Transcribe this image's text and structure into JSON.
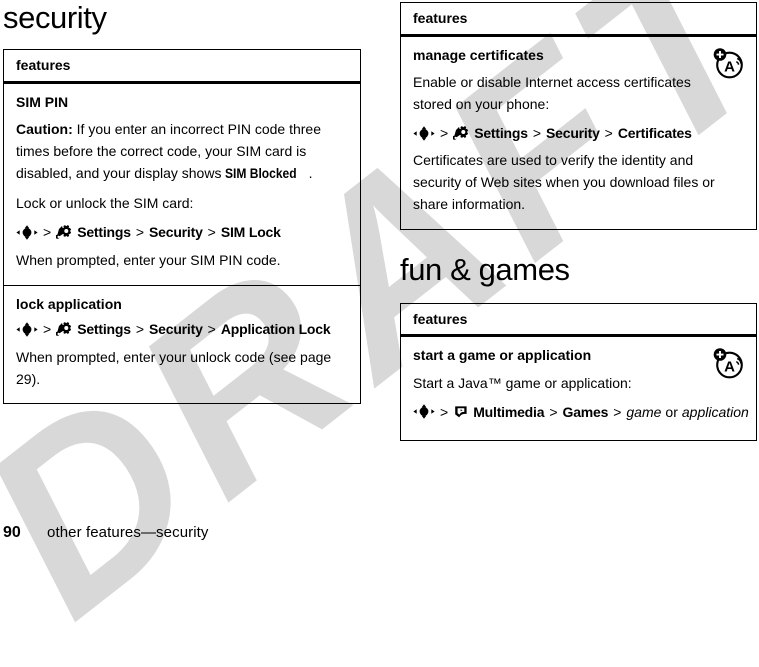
{
  "watermark": {
    "text": "DRAFT"
  },
  "footer": {
    "page_number": "90",
    "running_head": "other features—security"
  },
  "colors": {
    "text": "#000000",
    "rule": "#000000",
    "watermark": "#d8d8d8",
    "background": "#ffffff"
  },
  "left_column": {
    "chapter_title": "security",
    "table": {
      "header": "features",
      "rows": [
        {
          "title": "SIM PIN",
          "blocks": [
            {
              "kind": "paragraph",
              "runs": [
                {
                  "text": "Caution:",
                  "style": "bold"
                },
                {
                  "text": " If you enter an incorrect PIN code three times before the correct code, your SIM card is disabled, and your display shows ",
                  "style": "normal"
                },
                {
                  "text": "SIM Blocked",
                  "style": "screen"
                },
                {
                  "text": ".",
                  "style": "normal"
                }
              ]
            },
            {
              "kind": "paragraph",
              "runs": [
                {
                  "text": "Lock or unlock the SIM card:",
                  "style": "normal"
                }
              ]
            },
            {
              "kind": "menu_path",
              "items": [
                {
                  "type": "icon",
                  "icon": "nav-key-icon"
                },
                {
                  "type": "sep",
                  "text": ">"
                },
                {
                  "type": "icon",
                  "icon": "settings-gear-icon"
                },
                {
                  "type": "label",
                  "text": "Settings"
                },
                {
                  "type": "sep",
                  "text": ">"
                },
                {
                  "type": "label",
                  "text": "Security"
                },
                {
                  "type": "sep",
                  "text": ">"
                },
                {
                  "type": "label",
                  "text": "SIM Lock"
                }
              ]
            },
            {
              "kind": "paragraph",
              "runs": [
                {
                  "text": "When prompted, enter your SIM PIN code.",
                  "style": "normal"
                }
              ]
            }
          ]
        },
        {
          "title": "lock application",
          "blocks": [
            {
              "kind": "menu_path",
              "items": [
                {
                  "type": "icon",
                  "icon": "nav-key-icon"
                },
                {
                  "type": "sep",
                  "text": ">"
                },
                {
                  "type": "icon",
                  "icon": "settings-gear-icon"
                },
                {
                  "type": "label",
                  "text": "Settings"
                },
                {
                  "type": "sep",
                  "text": ">"
                },
                {
                  "type": "label",
                  "text": "Security"
                },
                {
                  "type": "sep",
                  "text": ">"
                },
                {
                  "type": "label",
                  "text": "Application Lock"
                }
              ]
            },
            {
              "kind": "paragraph",
              "runs": [
                {
                  "text": "When prompted, enter your unlock code (see page 29).",
                  "style": "normal"
                }
              ]
            }
          ]
        }
      ]
    }
  },
  "right_column": {
    "top_table": {
      "header": "features",
      "rows": [
        {
          "title": "manage certificates",
          "badge_icon": "voice-command-a-icon",
          "blocks": [
            {
              "kind": "paragraph",
              "runs": [
                {
                  "text": "Enable or disable Internet access certificates stored on your phone:",
                  "style": "normal"
                }
              ]
            },
            {
              "kind": "menu_path",
              "items": [
                {
                  "type": "icon",
                  "icon": "nav-key-icon"
                },
                {
                  "type": "sep",
                  "text": ">"
                },
                {
                  "type": "icon",
                  "icon": "settings-gear-icon"
                },
                {
                  "type": "label",
                  "text": "Settings"
                },
                {
                  "type": "sep",
                  "text": ">"
                },
                {
                  "type": "label",
                  "text": "Security"
                },
                {
                  "type": "sep",
                  "text": ">"
                },
                {
                  "type": "label",
                  "text": "Certificates"
                }
              ]
            },
            {
              "kind": "paragraph",
              "runs": [
                {
                  "text": "Certificates are used to verify the identity and security of Web sites when you download files or share information.",
                  "style": "normal"
                }
              ]
            }
          ]
        }
      ]
    },
    "chapter_title": "fun & games",
    "bottom_table": {
      "header": "features",
      "rows": [
        {
          "title": "start a game or application",
          "badge_icon": "voice-command-a-icon",
          "blocks": [
            {
              "kind": "paragraph",
              "runs": [
                {
                  "text": "Start a Java™ game or application:",
                  "style": "normal"
                }
              ]
            },
            {
              "kind": "menu_path",
              "items": [
                {
                  "type": "icon",
                  "icon": "nav-key-icon"
                },
                {
                  "type": "sep",
                  "text": ">"
                },
                {
                  "type": "icon",
                  "icon": "multimedia-icon"
                },
                {
                  "type": "label",
                  "text": "Multimedia"
                },
                {
                  "type": "sep",
                  "text": ">"
                },
                {
                  "type": "label",
                  "text": "Games"
                },
                {
                  "type": "sep",
                  "text": ">"
                },
                {
                  "type": "label-italic",
                  "text": "game"
                },
                {
                  "type": "plain",
                  "text": "or"
                },
                {
                  "type": "label-italic",
                  "text": "application"
                }
              ]
            }
          ]
        }
      ]
    }
  }
}
